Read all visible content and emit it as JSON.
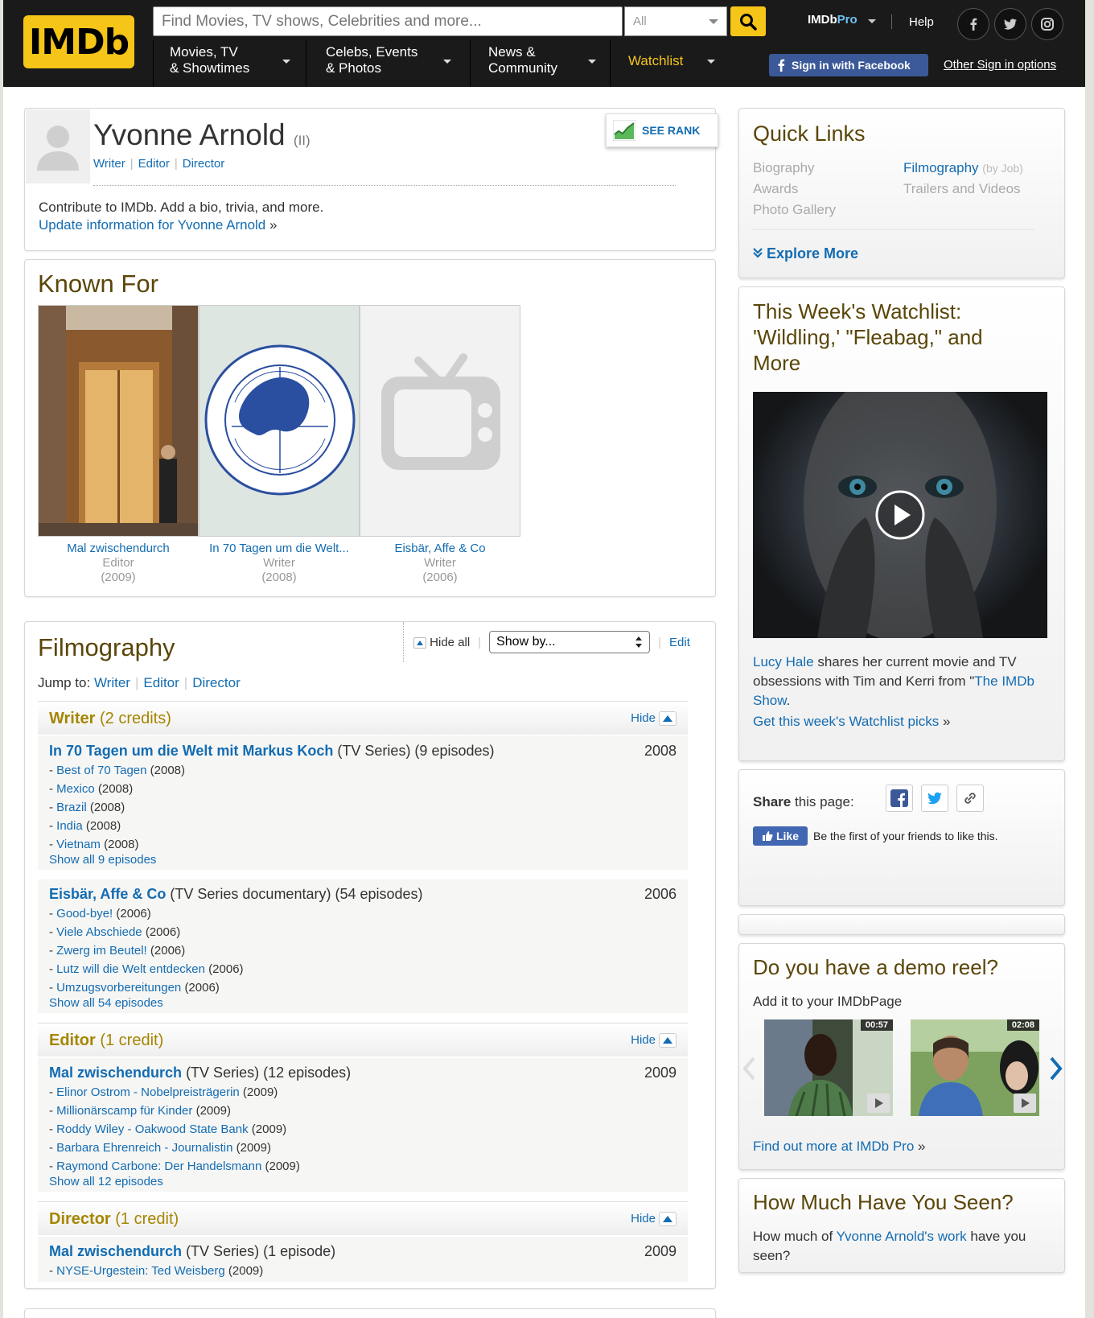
{
  "header": {
    "logo": "IMDb",
    "search_placeholder": "Find Movies, TV shows, Celebrities and more...",
    "search_category": "All",
    "pro_prefix": "IMDb",
    "pro_suffix": "Pro",
    "help": "Help",
    "nav": [
      {
        "line1": "Movies, TV",
        "line2": "& Showtimes"
      },
      {
        "line1": "Celebs, Events",
        "line2": "& Photos"
      },
      {
        "line1": "News &",
        "line2": "Community"
      }
    ],
    "watchlist": "Watchlist",
    "facebook_signin": "Sign in with Facebook",
    "other_signin": "Other Sign in options"
  },
  "person": {
    "name": "Yvonne Arnold",
    "suffix": "(II)",
    "roles": [
      "Writer",
      "Editor",
      "Director"
    ],
    "see_rank": "SEE RANK",
    "contribute": "Contribute to IMDb. Add a bio, trivia, and more.",
    "update_link": "Update information for Yvonne Arnold",
    "raquo": "»"
  },
  "known_for": {
    "title": "Known For",
    "items": [
      {
        "title": "Mal zwischendurch",
        "role": "Editor",
        "year": "(2009)"
      },
      {
        "title": "In 70 Tagen um die Welt...",
        "role": "Writer",
        "year": "(2008)"
      },
      {
        "title": "Eisbär, Affe & Co",
        "role": "Writer",
        "year": "(2006)"
      }
    ]
  },
  "filmography": {
    "title": "Filmography",
    "hide_all": "Hide all",
    "show_by": "Show by...",
    "edit": "Edit",
    "jump_label": "Jump to:",
    "jump": [
      "Writer",
      "Editor",
      "Director"
    ],
    "hide": "Hide",
    "sections": {
      "writer": {
        "name": "Writer",
        "count": "(2 credits)"
      },
      "editor": {
        "name": "Editor",
        "count": "(1 credit)"
      },
      "director": {
        "name": "Director",
        "count": "(1 credit)"
      }
    },
    "credits": {
      "w1": {
        "title": "In 70 Tagen um die Welt mit Markus Koch",
        "meta": "(TV Series) (9 episodes)",
        "year": "2008",
        "episodes": [
          {
            "t": "Best of 70 Tagen",
            "y": "(2008)"
          },
          {
            "t": "Mexico",
            "y": "(2008)"
          },
          {
            "t": "Brazil",
            "y": "(2008)"
          },
          {
            "t": "India",
            "y": "(2008)"
          },
          {
            "t": "Vietnam",
            "y": "(2008)"
          }
        ],
        "more": "Show all 9 episodes"
      },
      "w2": {
        "title": "Eisbär, Affe & Co",
        "meta": "(TV Series documentary) (54 episodes)",
        "year": "2006",
        "episodes": [
          {
            "t": "Good-bye!",
            "y": "(2006)"
          },
          {
            "t": "Viele Abschiede",
            "y": "(2006)"
          },
          {
            "t": "Zwerg im Beutel!",
            "y": "(2006)"
          },
          {
            "t": "Lutz will die Welt entdecken",
            "y": "(2006)"
          },
          {
            "t": "Umzugsvorbereitungen",
            "y": "(2006)"
          }
        ],
        "more": "Show all 54 episodes"
      },
      "e1": {
        "title": "Mal zwischendurch",
        "meta": "(TV Series) (12 episodes)",
        "year": "2009",
        "episodes": [
          {
            "t": "Elinor Ostrom - Nobelpreisträgerin",
            "y": "(2009)"
          },
          {
            "t": "Millionärscamp für Kinder",
            "y": "(2009)"
          },
          {
            "t": "Roddy Wiley - Oakwood State Bank",
            "y": "(2009)"
          },
          {
            "t": "Barbara Ehrenreich - Journalistin",
            "y": "(2009)"
          },
          {
            "t": "Raymond Carbone: Der Handelsmann",
            "y": "(2009)"
          }
        ],
        "more": "Show all 12 episodes"
      },
      "d1": {
        "title": "Mal zwischendurch",
        "meta": "(TV Series) (1 episode)",
        "year": "2009",
        "episodes": [
          {
            "t": "NYSE-Urgestein: Ted Weisberg",
            "y": "(2009)"
          }
        ]
      }
    }
  },
  "quick_links": {
    "title": "Quick Links",
    "biography": "Biography",
    "awards": "Awards",
    "photo_gallery": "Photo Gallery",
    "filmography": "Filmography",
    "by_job": "(by Job)",
    "trailers": "Trailers and Videos",
    "explore": "Explore More"
  },
  "watchlist_card": {
    "title": "This Week's Watchlist: 'Wildling,' \"Fleabag,\" and More",
    "link_person": "Lucy Hale",
    "text_mid": " shares her current movie and TV obsessions with Tim and Kerri from \"",
    "link_show": "The IMDb Show",
    "text_end": ".",
    "cta": "Get this week's Watchlist picks"
  },
  "share": {
    "label_bold": "Share",
    "label_rest": " this page:",
    "like": "Like",
    "like_text": "Be the first of your friends to like this."
  },
  "demo_reel": {
    "title": "Do you have a demo reel?",
    "subtitle": "Add it to your IMDbPage",
    "thumbs": [
      {
        "duration": "00:57"
      },
      {
        "duration": "02:08"
      }
    ],
    "cta": "Find out more at IMDb Pro"
  },
  "how_much": {
    "title": "How Much Have You Seen?",
    "pre": "How much of ",
    "link": "Yvonne Arnold's work",
    "post": " have you seen?"
  }
}
